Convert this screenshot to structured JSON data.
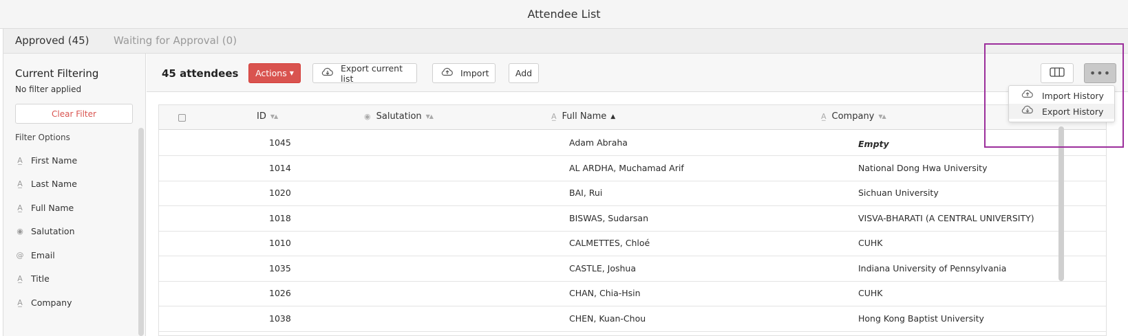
{
  "window": {
    "title": "Attendee List"
  },
  "tabs": [
    {
      "label": "Approved (45)",
      "active": true
    },
    {
      "label": "Waiting for Approval (0)",
      "active": false
    }
  ],
  "sidebar": {
    "title": "Current Filtering",
    "status": "No filter applied",
    "clear_label": "Clear Filter",
    "options_label": "Filter Options",
    "filters": [
      {
        "label": "First Name",
        "icon": "text-field-icon"
      },
      {
        "label": "Last Name",
        "icon": "text-field-icon"
      },
      {
        "label": "Full Name",
        "icon": "text-field-icon"
      },
      {
        "label": "Salutation",
        "icon": "radio-field-icon"
      },
      {
        "label": "Email",
        "icon": "at-sign-icon"
      },
      {
        "label": "Title",
        "icon": "text-field-icon"
      },
      {
        "label": "Company",
        "icon": "text-field-icon"
      }
    ]
  },
  "toolbar": {
    "count_label": "45 attendees",
    "actions_label": "Actions",
    "export_label": "Export current list",
    "import_label": "Import",
    "add_label": "Add"
  },
  "more_menu": {
    "items": [
      {
        "label": "Import History",
        "icon": "cloud-upload-icon"
      },
      {
        "label": "Export History",
        "icon": "cloud-download-icon"
      }
    ]
  },
  "table": {
    "columns": [
      {
        "label": "ID",
        "sort": "none"
      },
      {
        "label": "Salutation",
        "sort": "none"
      },
      {
        "label": "Full Name",
        "sort": "asc"
      },
      {
        "label": "Company",
        "sort": "none"
      }
    ],
    "rows": [
      {
        "id": "1045",
        "salutation": "",
        "full_name": "Adam Abraha",
        "company": "Empty"
      },
      {
        "id": "1014",
        "salutation": "",
        "full_name": "AL ARDHA, Muchamad Arif",
        "company": "National Dong Hwa University"
      },
      {
        "id": "1020",
        "salutation": "",
        "full_name": "BAI, Rui",
        "company": "Sichuan University"
      },
      {
        "id": "1018",
        "salutation": "",
        "full_name": "BISWAS, Sudarsan",
        "company": "VISVA-BHARATI (A CENTRAL UNIVERSITY)"
      },
      {
        "id": "1010",
        "salutation": "",
        "full_name": "CALMETTES, Chloé",
        "company": "CUHK"
      },
      {
        "id": "1035",
        "salutation": "",
        "full_name": "CASTLE, Joshua",
        "company": "Indiana University of Pennsylvania"
      },
      {
        "id": "1026",
        "salutation": "",
        "full_name": "CHAN, Chia-Hsin",
        "company": "CUHK"
      },
      {
        "id": "1038",
        "salutation": "",
        "full_name": "CHEN, Kuan-Chou",
        "company": "Hong Kong Baptist University"
      }
    ]
  },
  "colors": {
    "accent_red": "#d9534f",
    "highlight_purple": "#9b2d9b"
  }
}
